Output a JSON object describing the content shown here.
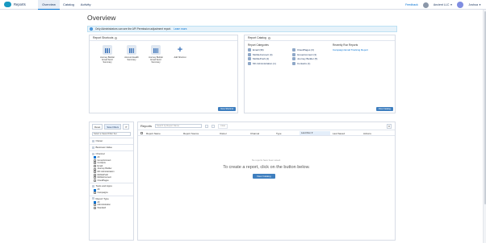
{
  "app": {
    "name": "Reports"
  },
  "tabs": [
    {
      "label": "Overview"
    },
    {
      "label": "Catalog"
    },
    {
      "label": "Activity"
    }
  ],
  "topbar": {
    "feedback": "Feedback",
    "account": "Ancient LLC",
    "user": "Joshua"
  },
  "page": {
    "title": "Overview"
  },
  "banner": {
    "text": "Only Administrators can see the API Permission adjustment report.",
    "link": "Learn more."
  },
  "shortcuts_card": {
    "title": "Report Shortcuts",
    "button": "New Shortcut",
    "items": [
      {
        "label": "Journey Builder Email Send Summary"
      },
      {
        "label": "Account Health Summary"
      },
      {
        "label": "Journey Builder Email Send Summary"
      },
      {
        "label": "Add Shortcut"
      }
    ]
  },
  "catalog_card": {
    "title": "Report Catalog",
    "categories_label": "Report Categories",
    "categories": [
      {
        "label": "Email (36)"
      },
      {
        "label": "CloudPages (3)"
      },
      {
        "label": "MobileConnect (4)"
      },
      {
        "label": "GroupConnect (3)"
      },
      {
        "label": "MobilePush (4)"
      },
      {
        "label": "Journey Builder (5)"
      },
      {
        "label": "MC Administration (1)"
      },
      {
        "label": "Contacts (1)"
      }
    ],
    "recent_label": "Recently Run Reports",
    "recent_link": "Campaign Email Tracking Report",
    "button": "View Catalog"
  },
  "filters": {
    "reset": "Reset",
    "save": "Save Filters",
    "select": "Select a Saved Filter Set",
    "groups": [
      {
        "title": "Owner",
        "options": []
      },
      {
        "title": "Business Value",
        "options": []
      },
      {
        "title": "Channel",
        "options": [
          {
            "label": "All",
            "checked": true
          },
          {
            "label": "GroupConnect",
            "checked": false
          },
          {
            "label": "Contacts",
            "checked": false
          },
          {
            "label": "Email",
            "checked": false
          },
          {
            "label": "Journey Builder",
            "checked": false
          },
          {
            "label": "MC Administration",
            "checked": false
          },
          {
            "label": "MobilePush",
            "checked": false
          },
          {
            "label": "MobileConnect",
            "checked": false
          },
          {
            "label": "CloudPages",
            "checked": false
          }
        ]
      },
      {
        "title": "Tools and Apps",
        "options": [
          {
            "label": "All",
            "checked": true
          },
          {
            "label": "Campaigns",
            "checked": false
          }
        ]
      },
      {
        "title": "Report Type",
        "options": [
          {
            "label": "All",
            "checked": true
          },
          {
            "label": "Administration",
            "checked": false
          },
          {
            "label": "Standard",
            "checked": false
          }
        ]
      }
    ]
  },
  "reports": {
    "label": "Reports",
    "search_placeholder": "Search by Report Name",
    "clear": "Clear",
    "columns": [
      "Report Name",
      "Report Source",
      "Owner",
      "Channel",
      "Type",
      "Last Run",
      "Last Saved",
      "Actions"
    ],
    "empty_note": "No reports have been saved.",
    "empty_message": "To create a report, click on the button below.",
    "button": "View Catalog"
  },
  "colors": {
    "accent": "#0070d2",
    "button": "#3f7fbf",
    "banner_bg": "#e6f2fa"
  }
}
